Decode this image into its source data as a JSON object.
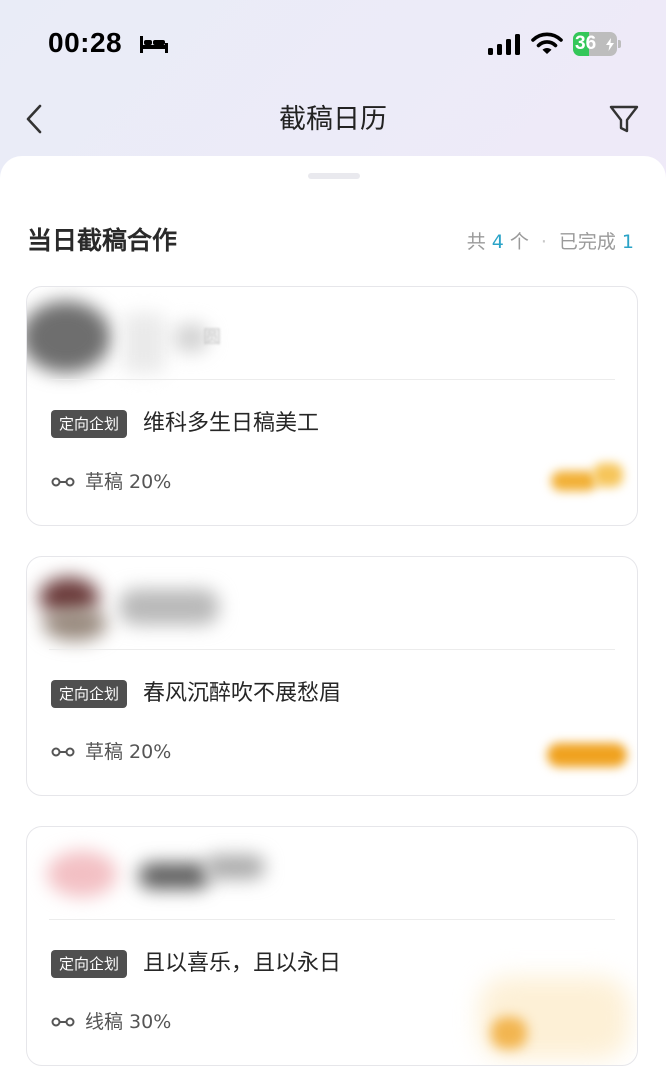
{
  "status_bar": {
    "time": "00:28",
    "battery": "36",
    "battery_level": 0.36,
    "icons": [
      "bed-icon",
      "signal-icon",
      "wifi-icon",
      "battery-icon"
    ]
  },
  "nav": {
    "title": "截稿日历",
    "back_icon": "chevron-left-icon",
    "filter_icon": "filter-icon"
  },
  "section": {
    "title": "当日截稿合作",
    "total_prefix": "共",
    "total": "4",
    "total_suffix": "个",
    "completed_label": "已完成",
    "completed": "1"
  },
  "colors": {
    "accent": "#2aa3c7",
    "tag_bg": "#4f4f4f",
    "battery_green": "#34c759"
  },
  "cards": [
    {
      "account": "圆",
      "tag": "定向企划",
      "title": "维科多生日稿美工",
      "stage": "草稿 20%"
    },
    {
      "account": "",
      "tag": "定向企划",
      "title": "春风沉醉吹不展愁眉",
      "stage": "草稿 20%"
    },
    {
      "account": "",
      "tag": "定向企划",
      "title": "且以喜乐，且以永日",
      "stage": "线稿 30%"
    }
  ]
}
